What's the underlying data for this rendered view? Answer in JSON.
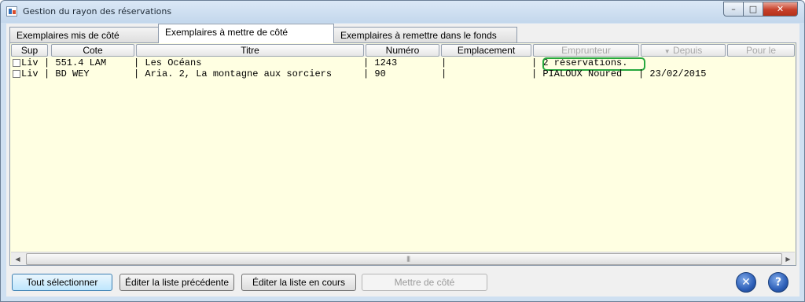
{
  "window": {
    "title": "Gestion du rayon des réservations"
  },
  "titlebar_buttons": {
    "minimize": "–",
    "maximize": "□",
    "close": "✕"
  },
  "tabs": [
    {
      "label": "Exemplaires mis de côté",
      "active": false
    },
    {
      "label": "Exemplaires à mettre de côté",
      "active": true
    },
    {
      "label": "Exemplaires à remettre dans le fonds",
      "active": false
    }
  ],
  "columns": {
    "sup": "Sup",
    "cote": "Cote",
    "titre": "Titre",
    "numero": "Numéro",
    "emplacement": "Emplacement",
    "emprunteur": "Emprunteur",
    "depuis": "Depuis",
    "pour_le": "Pour le"
  },
  "sort_indicator": "▼",
  "rows": [
    {
      "type": "Liv",
      "cote": "| 551.4 LAM",
      "titre": "| Les Océans",
      "numero": "| 1243",
      "emplacement": "|",
      "emprunteur": "| 2 réservations.",
      "depuis": "",
      "highlighted": true
    },
    {
      "type": "Liv",
      "cote": "| BD WEY",
      "titre": "| Aria. 2, La montagne aux sorciers",
      "numero": "| 90",
      "emplacement": "|",
      "emprunteur": "| PIALOUX Noured",
      "depuis": "| 23/02/2015",
      "highlighted": false
    }
  ],
  "scrollbar": {
    "left_arrow": "◀",
    "right_arrow": "▶",
    "grip": "|||"
  },
  "buttons": {
    "select_all": "Tout sélectionner",
    "edit_previous": "Éditer la liste précédente",
    "edit_current": "Éditer la liste en cours",
    "set_aside": "Mettre de côté"
  },
  "icon_buttons": {
    "close_glyph": "✕",
    "help_glyph": "?"
  },
  "colors": {
    "grid_background": "#ffffe2",
    "highlight_border": "#26a83e",
    "round_button": "#2d5fb8"
  }
}
